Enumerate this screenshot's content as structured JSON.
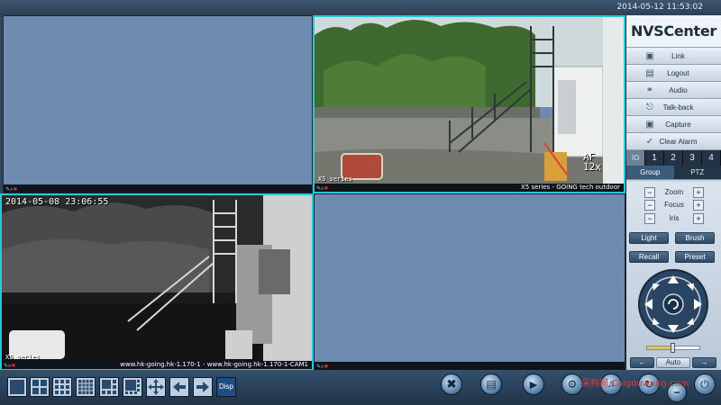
{
  "header": {
    "datetime": "2014-05-12 11:53:02"
  },
  "panes": [
    {
      "id": "pane-1",
      "state": "empty",
      "osd_time": "",
      "status_text": ""
    },
    {
      "id": "pane-2",
      "state": "live-color",
      "osd_cam": "X5 series",
      "osd_zoom": "AF\n12x",
      "status_text": "X5 series - GOING tech outdoor"
    },
    {
      "id": "pane-3",
      "state": "live-night",
      "osd_time": "2014-05-08 23:06:55",
      "osd_cam": "X5 series",
      "status_text": "www.hk-going.hk-1.170-1 - www.hk-going.hk-1.170-1-CAM1"
    },
    {
      "id": "pane-4",
      "state": "empty",
      "status_text": ""
    }
  ],
  "sidebar": {
    "logo": "NVSCenter",
    "buttons": [
      {
        "label": "Link",
        "icon": "link-icon"
      },
      {
        "label": "Logout",
        "icon": "logout-icon"
      },
      {
        "label": "Audio",
        "icon": "headphones-icon"
      },
      {
        "label": "Talk-back",
        "icon": "microphone-icon"
      },
      {
        "label": "Capture",
        "icon": "camera-icon"
      },
      {
        "label": "Clear Alarm",
        "icon": "clear-alarm-icon"
      }
    ],
    "channels": {
      "io": "IO",
      "items": [
        "1",
        "2",
        "3",
        "4"
      ]
    },
    "tabs": [
      {
        "label": "Group",
        "active": false
      },
      {
        "label": "PTZ",
        "active": true
      }
    ],
    "ptz": {
      "adjust": [
        "Zoom",
        "Focus",
        "Iris"
      ],
      "buttons": [
        "Light",
        "Brush",
        "Recall",
        "Preset"
      ],
      "speed_level": 0.5,
      "auto_label": "Auto"
    }
  },
  "bottombar": {
    "layouts": [
      "layout-1x1-icon",
      "layout-2x2-icon",
      "layout-3x3-icon",
      "layout-4x4-icon",
      "layout-1plus5-icon",
      "layout-1plus7-icon",
      "move-icon",
      "prev-icon",
      "next-icon"
    ],
    "disp_label": "Disp",
    "controls": [
      "stop-all-icon",
      "record-icon",
      "playback-icon",
      "settings-icon",
      "volume-icon",
      "minimize-icon",
      "power-icon"
    ]
  },
  "watermark": "采购网 Caigouwang.com"
}
